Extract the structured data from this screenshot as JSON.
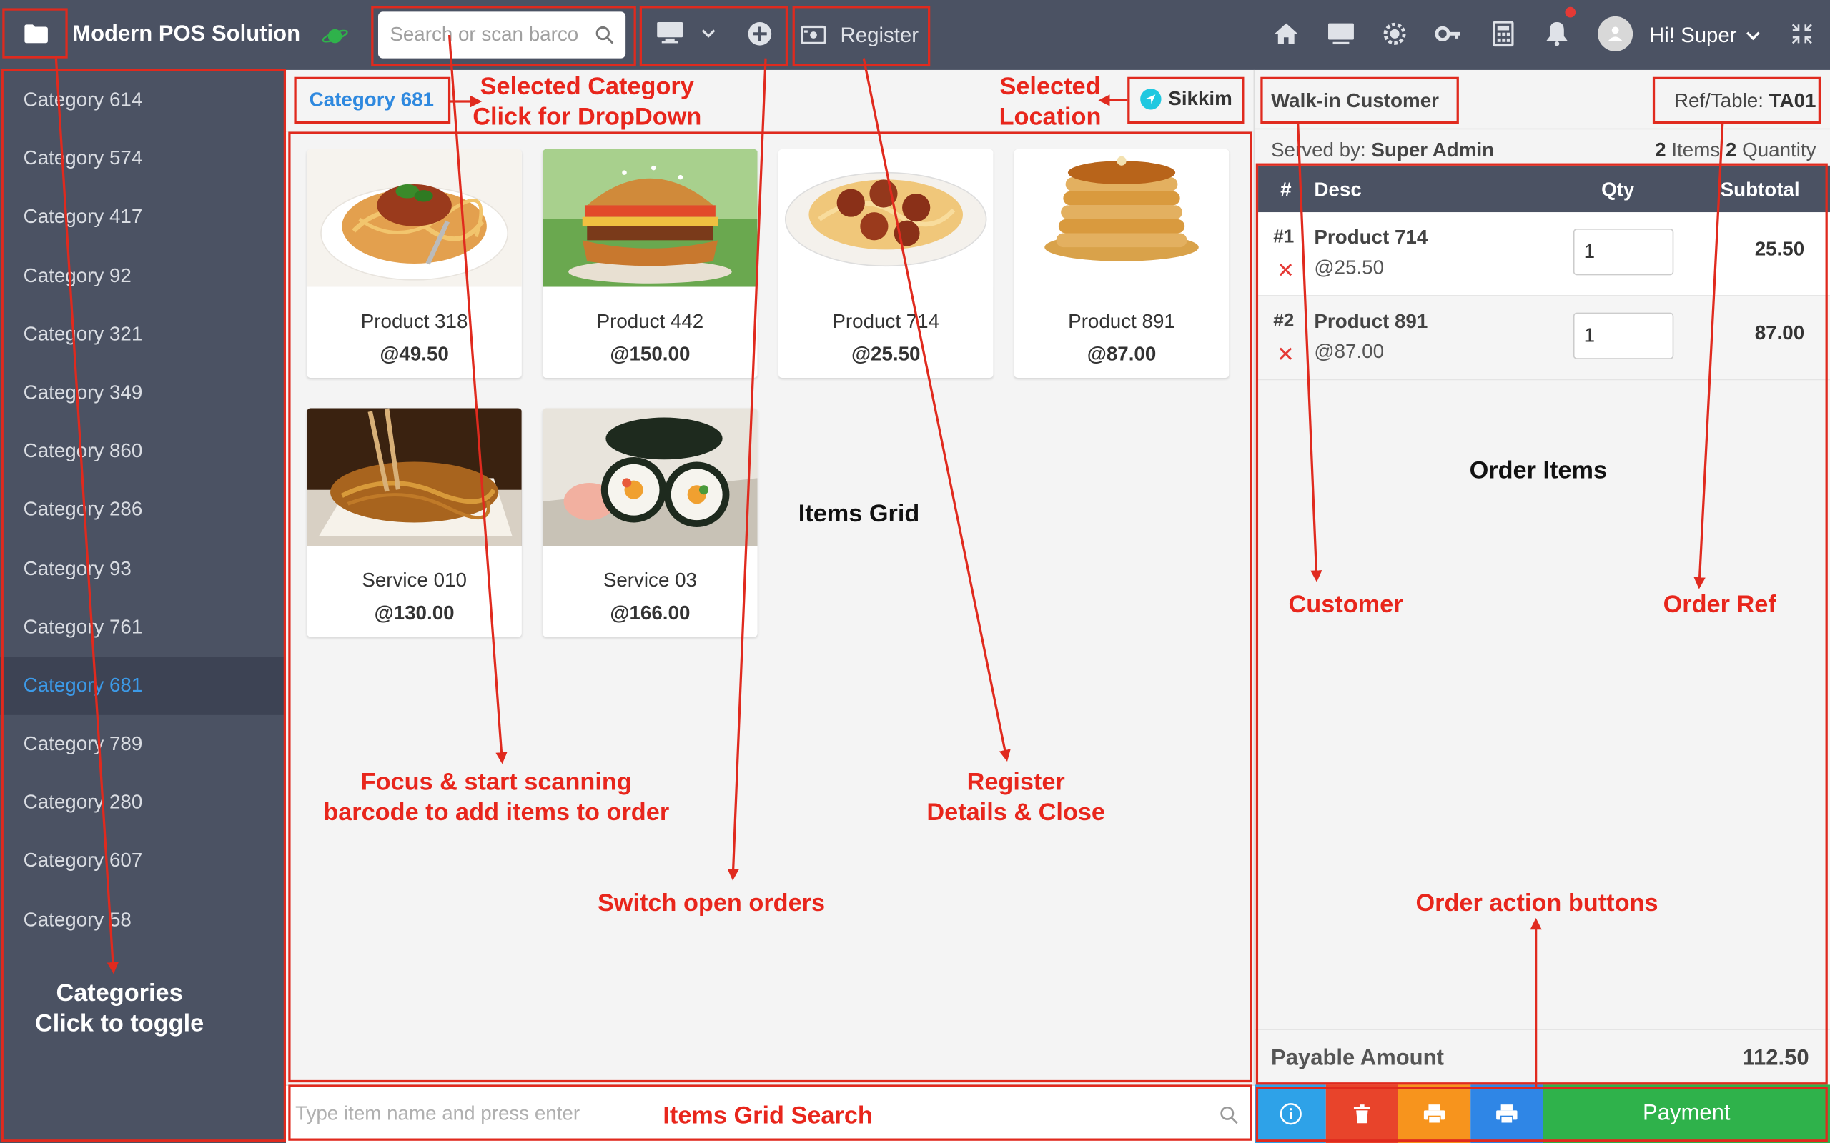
{
  "app": {
    "title": "Modern POS Solution"
  },
  "topbar": {
    "search_placeholder": "Search or scan barco",
    "register_label": "Register",
    "user_greeting": "Hi! Super"
  },
  "sidebar": {
    "categories": [
      "Category 614",
      "Category 574",
      "Category 417",
      "Category 92",
      "Category 321",
      "Category 349",
      "Category 860",
      "Category 286",
      "Category 93",
      "Category 761",
      "Category 681",
      "Category 789",
      "Category 280",
      "Category 607",
      "Category 58"
    ],
    "active_index": 10
  },
  "center": {
    "selected_category": "Category 681",
    "location": "Sikkim",
    "products": [
      {
        "name": "Product 318",
        "price": "@49.50",
        "image": "spaghetti-bolognese"
      },
      {
        "name": "Product 442",
        "price": "@150.00",
        "image": "burger"
      },
      {
        "name": "Product 714",
        "price": "@25.50",
        "image": "spaghetti-meatballs"
      },
      {
        "name": "Product 891",
        "price": "@87.00",
        "image": "pancakes"
      },
      {
        "name": "Service 010",
        "price": "@130.00",
        "image": "noodles"
      },
      {
        "name": "Service 03",
        "price": "@166.00",
        "image": "sushi"
      }
    ],
    "grid_search_placeholder": "Type item name and press enter"
  },
  "order": {
    "customer": "Walk-in Customer",
    "ref_label": "Ref/Table:",
    "ref_value": "TA01",
    "served_label": "Served by:",
    "served_by": "Super Admin",
    "items_count": "2",
    "items_label": "Items",
    "quantity_count": "2",
    "quantity_label": "Quantity",
    "columns": {
      "num": "#",
      "desc": "Desc",
      "qty": "Qty",
      "subtotal": "Subtotal"
    },
    "items": [
      {
        "num": "#1",
        "name": "Product 714",
        "each": "@25.50",
        "qty": "1",
        "subtotal": "25.50"
      },
      {
        "num": "#2",
        "name": "Product 891",
        "each": "@87.00",
        "qty": "1",
        "subtotal": "87.00"
      }
    ],
    "payable_label": "Payable Amount",
    "payable_amount": "112.50",
    "payment_label": "Payment",
    "action_colors": {
      "info": "#2ea2e8",
      "delete": "#e8442b",
      "print": "#f7941d",
      "print2": "#2f86e6",
      "payment": "#2fb24b"
    }
  },
  "annotations": {
    "selected_category": [
      "Selected Category",
      "Click for DropDown"
    ],
    "selected_location": [
      "Selected",
      "Location"
    ],
    "items_grid": "Items Grid",
    "focus_scan": [
      "Focus & start scanning",
      "barcode to add items to order"
    ],
    "register_details": [
      "Register",
      "Details & Close"
    ],
    "switch_orders": "Switch open orders",
    "items_grid_search": "Items Grid Search",
    "categories": [
      "Categories",
      "Click to toggle"
    ],
    "order_items": "Order Items",
    "customer": "Customer",
    "order_ref": "Order Ref",
    "order_actions": "Order action buttons"
  }
}
